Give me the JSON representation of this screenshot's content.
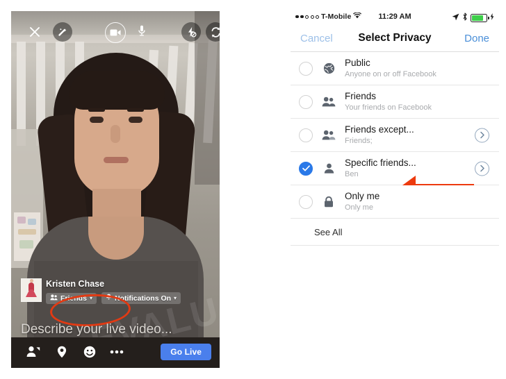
{
  "left_panel": {
    "name": "facebook-live-composer",
    "top_toolbar": [
      {
        "icon": "close-icon",
        "label": "Close"
      },
      {
        "icon": "magic-wand-icon",
        "label": "Effects"
      },
      {
        "icon": "video-camera-icon",
        "label": "Video",
        "active": true
      },
      {
        "icon": "microphone-icon",
        "label": "Audio"
      },
      {
        "icon": "flash-off-icon",
        "label": "Flash Off"
      },
      {
        "icon": "camera-flip-icon",
        "label": "Flip Camera"
      }
    ],
    "user_name": "Kristen Chase",
    "privacy_chip": {
      "label": "Friends",
      "icon": "friends-icon",
      "caret": "▾"
    },
    "notifications_chip": {
      "label": "Notifications On",
      "icon": "bell-icon",
      "caret": "▾"
    },
    "description_placeholder": "Describe your live video...",
    "bottom_toolbar": [
      {
        "icon": "tag-people-icon",
        "label": "Tag People"
      },
      {
        "icon": "location-pin-icon",
        "label": "Location"
      },
      {
        "icon": "emoji-icon",
        "label": "Feeling"
      },
      {
        "icon": "more-options-icon",
        "label": "More"
      }
    ],
    "go_live_label": "Go Live",
    "go_live_color": "#4a7fec",
    "annotation_ellipse_color": "#e23a13",
    "watermark_text": "EVALUATED"
  },
  "right_panel": {
    "name": "select-privacy-screen",
    "status_bar": {
      "signal_dots": "●●○○○",
      "carrier": "T-Mobile",
      "wifi_icon": "wifi-icon",
      "time": "11:29 AM",
      "location_icon": "location-arrow-icon",
      "bluetooth_icon": "bluetooth-icon",
      "battery_icon": "battery-charging-icon",
      "battery_color": "#3ecf4a"
    },
    "navbar": {
      "cancel_label": "Cancel",
      "title": "Select Privacy",
      "done_label": "Done",
      "cancel_color": "#9dc0e8",
      "done_color": "#4a8fd8"
    },
    "options": [
      {
        "title": "Public",
        "subtitle": "Anyone on or off Facebook",
        "icon": "globe-icon",
        "selected": false,
        "chevron": false
      },
      {
        "title": "Friends",
        "subtitle": "Your friends on Facebook",
        "icon": "friends-icon",
        "selected": false,
        "chevron": false
      },
      {
        "title": "Friends except...",
        "subtitle": "Friends;",
        "icon": "friends-except-icon",
        "selected": false,
        "chevron": true
      },
      {
        "title": "Specific friends...",
        "subtitle": "Ben",
        "icon": "person-icon",
        "selected": true,
        "chevron": true
      },
      {
        "title": "Only me",
        "subtitle": "Only me",
        "icon": "lock-icon",
        "selected": false,
        "chevron": false
      }
    ],
    "see_all_label": "See All",
    "selected_color": "#2a79e8",
    "annotation_arrow": {
      "icon": "left-arrow-annotation",
      "color": "#ed3a0e",
      "points_at": "Specific friends..."
    }
  }
}
